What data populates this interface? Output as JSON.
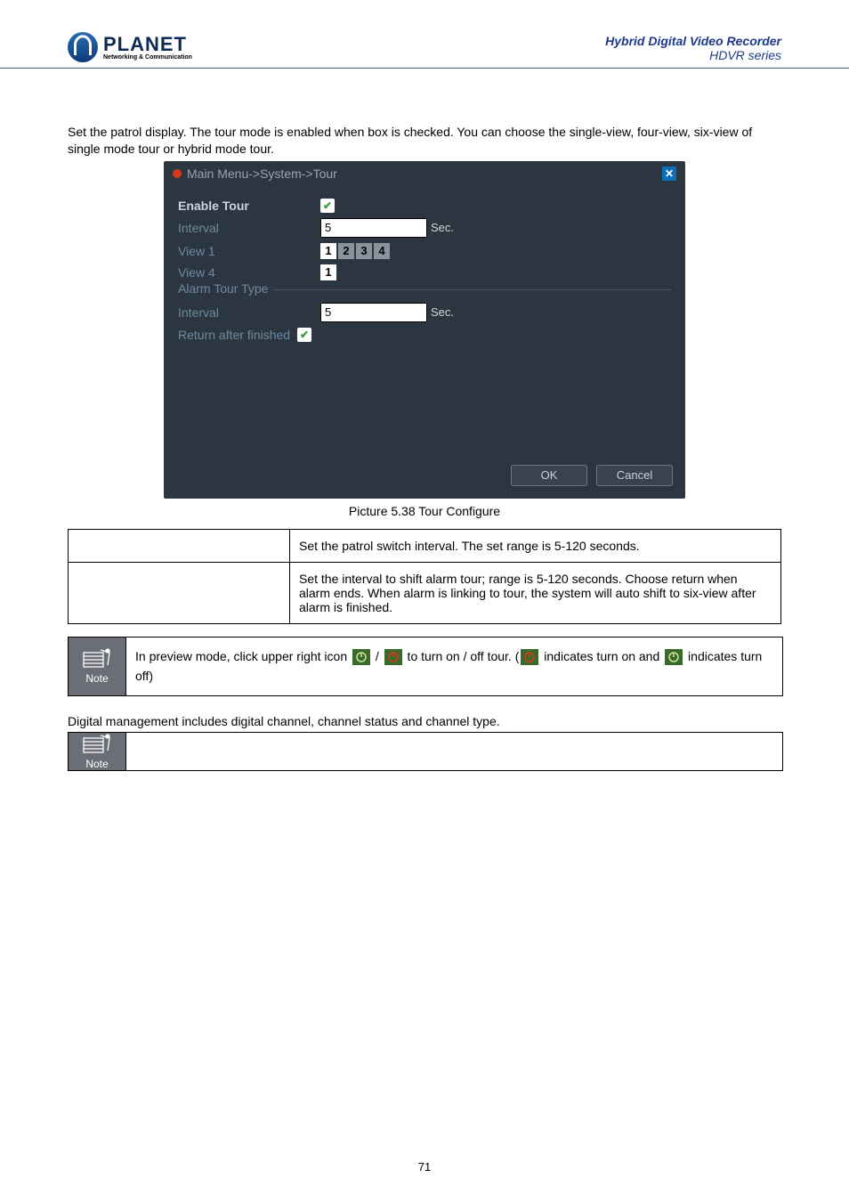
{
  "header": {
    "brand": "PLANET",
    "tagline": "Networking & Communication",
    "right1": "Hybrid Digital Video Recorder",
    "right2": "HDVR series"
  },
  "intro": "Set the patrol display. The tour mode is enabled when box is checked. You can choose the single-view, four-view, six-view of single mode tour or hybrid mode tour.",
  "dialog": {
    "title": "Main Menu->System->Tour",
    "enable": "Enable Tour",
    "interval": "Interval",
    "interval_val": "5",
    "unit": "Sec.",
    "view1": "View 1",
    "v1": [
      "1",
      "2",
      "3",
      "4"
    ],
    "view4": "View 4",
    "v4": "1",
    "alarmType": "Alarm Tour Type",
    "interval2": "Interval",
    "interval2_val": "5",
    "return": "Return after finished",
    "ok": "OK",
    "cancel": "Cancel"
  },
  "caption": "Picture 5.38 Tour Configure",
  "table": {
    "r1": "Set the patrol switch interval. The set range is 5-120 seconds.",
    "r2": "Set the interval to shift alarm tour; range is 5-120 seconds. Choose return when alarm ends. When alarm is linking to tour, the system will auto shift to six-view after alarm is finished."
  },
  "note1": {
    "label": "Note",
    "pre": "In preview mode, click upper right icon ",
    "mid": " / ",
    "post": " to turn on / off tour. (",
    "tail1": " indicates turn on and ",
    "tail2": " indicates turn off)"
  },
  "digital": "Digital management includes digital channel, channel status and channel type.",
  "note2": {
    "label": "Note"
  },
  "page": "71"
}
